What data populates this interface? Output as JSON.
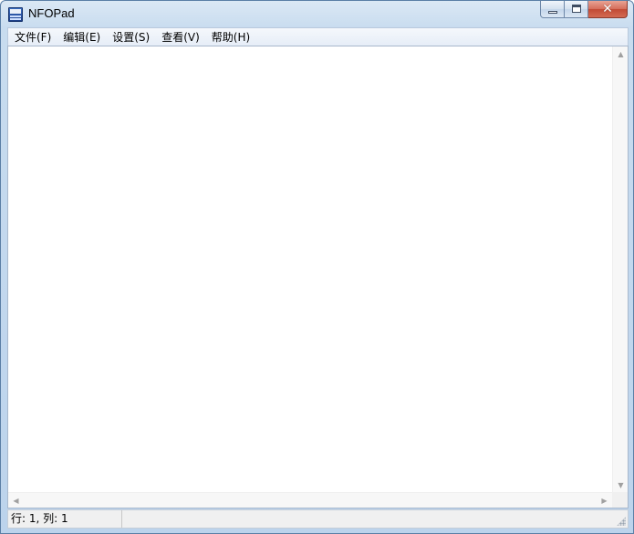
{
  "window": {
    "title": "NFOPad",
    "app_icon": "nfo-document-icon",
    "caption_buttons": {
      "minimize": "window-minimize-icon",
      "maximize": "window-maximize-icon",
      "close_glyph": "✕"
    }
  },
  "menubar": {
    "items": [
      {
        "label": "文件(F)"
      },
      {
        "label": "编辑(E)"
      },
      {
        "label": "设置(S)"
      },
      {
        "label": "查看(V)"
      },
      {
        "label": "帮助(H)"
      }
    ]
  },
  "editor": {
    "content": "",
    "scroll_up": "▲",
    "scroll_down": "▼",
    "scroll_left": "◀",
    "scroll_right": "▶"
  },
  "statusbar": {
    "position": "行: 1, 列: 1"
  },
  "colors": {
    "frame": "#bcd3ec",
    "close_button": "#c24a35"
  }
}
